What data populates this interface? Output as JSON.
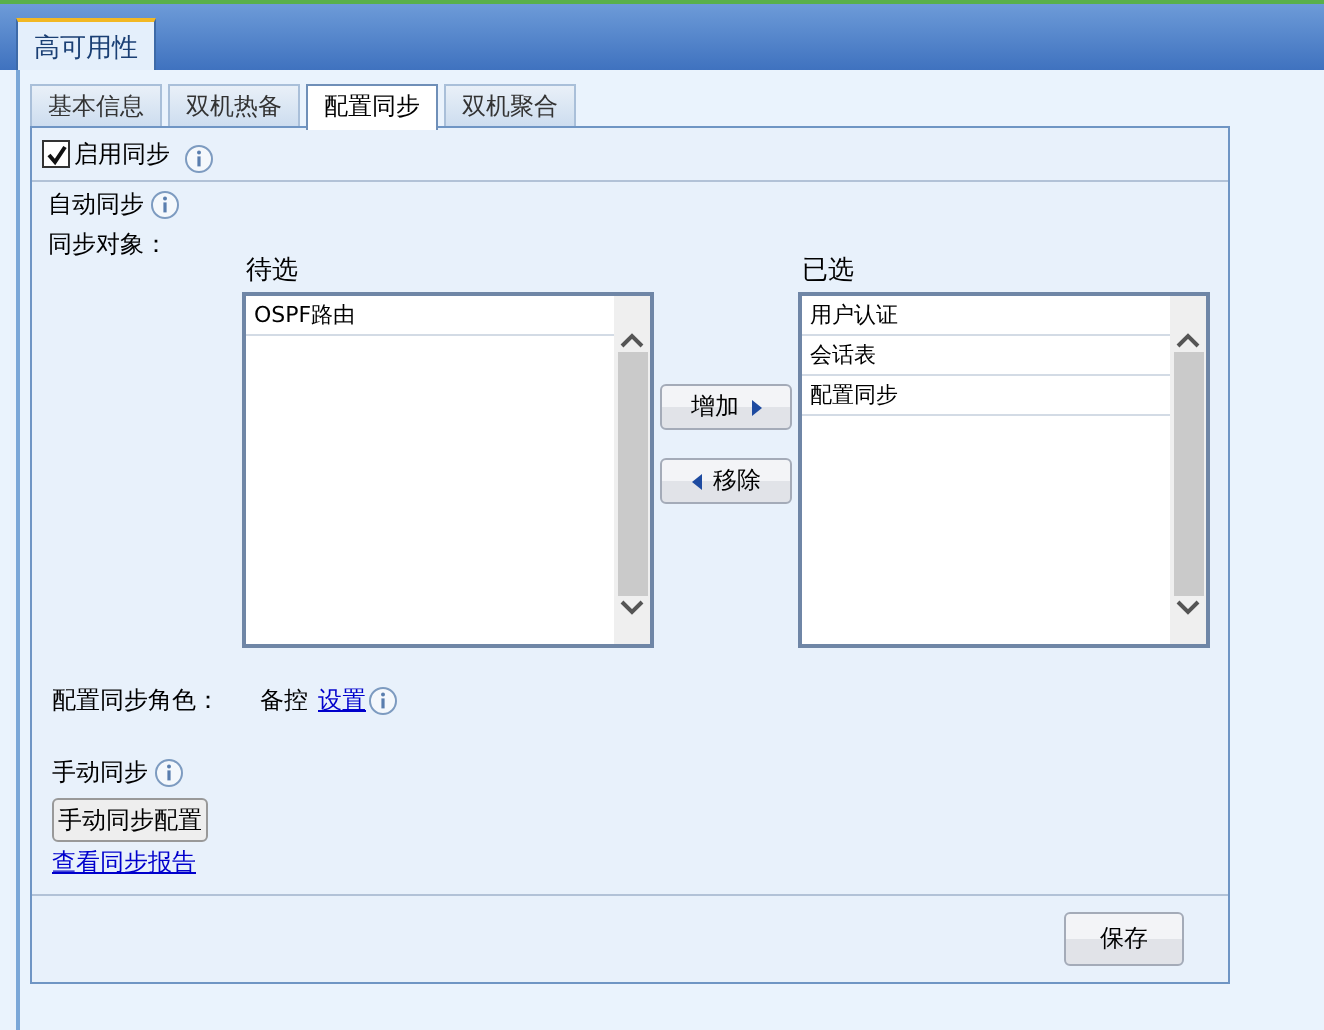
{
  "main_tab": {
    "label": "高可用性",
    "selected": true
  },
  "tabs": [
    {
      "label": "基本信息",
      "selected": false
    },
    {
      "label": "双机热备",
      "selected": false
    },
    {
      "label": "配置同步",
      "selected": true
    },
    {
      "label": "双机聚合",
      "selected": false
    }
  ],
  "enable_sync": {
    "label": "启用同步",
    "checked": true
  },
  "auto_sync": {
    "label": "自动同步"
  },
  "sync_objects": {
    "label": "同步对象：",
    "available": {
      "title": "待选",
      "items": [
        "OSPF路由"
      ]
    },
    "chosen": {
      "title": "已选",
      "items": [
        "用户认证",
        "会话表",
        "配置同步"
      ]
    },
    "add_button": "增加",
    "remove_button": "移除"
  },
  "sync_role": {
    "label": "配置同步角色：",
    "value": "备控",
    "link": "设置"
  },
  "manual_sync": {
    "label": "手动同步",
    "button": "手动同步配置",
    "report_link": "查看同步报告"
  },
  "save_button": "保存"
}
